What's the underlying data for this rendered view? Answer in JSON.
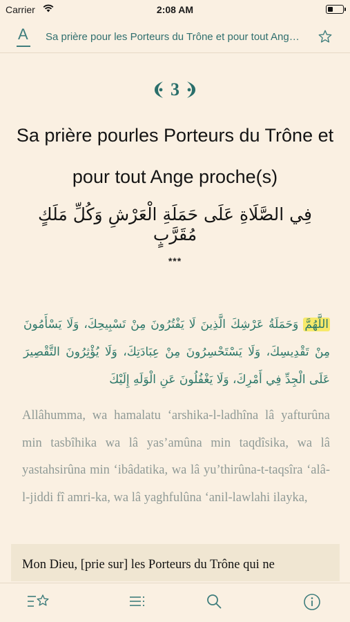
{
  "status_bar": {
    "carrier": "Carrier",
    "time": "2:08 AM"
  },
  "navbar": {
    "font_button": "A",
    "title": "Sa prière pour les Porteurs du Trône et pour tout Ange proche(s)"
  },
  "chapter": {
    "number": "3",
    "title": "Sa prière pourles Porteurs du Trône et pour tout Ange proche(s)",
    "arabic_title": "فِي الصَّلَاةِ عَلَى حَمَلَةِ الْعَرْشِ وَكُلِّ مَلَكٍ مُقَرَّبٍ",
    "separator": "***"
  },
  "verse": {
    "arabic_highlighted": "اللَّهُمَّ",
    "arabic_rest": " وَحَمَلَةُ عَرْشِكَ الَّذِينَ لَا يَفْتُرُونَ مِنْ تَسْبِيحِكَ، وَلَا يَسْأَمُونَ مِنْ تَقْدِيسِكَ، وَلَا يَسْتَحْسِرُونَ مِنْ عِبَادَتِكَ، وَلَا يُؤْثِرُونَ التَّقْصِيرَ عَلَى الْجِدِّ فِي أَمْرِكَ، وَلَا يَغْفُلُونَ عَنِ الْوَلَهِ إِلَيْكَ",
    "transliteration": "Allâhumma, wa hamalatu ‘arshika-l-ladhîna lâ yaf­turûna min tasbîhika wa lâ yas’amûna min taqdîsika, wa lâ yastahsirûna min ‘ibâdatika, wa lâ yu’thirûna-t-taqsîra ‘alâ-l-jiddi fî amri-ka, wa lâ yaghfulûna ‘anil-lawlahi ilayka,",
    "translation": "Mon Dieu, [prie sur] les Porteurs du Trône qui ne"
  },
  "colors": {
    "accent": "#2f6f6e",
    "arabic": "#2c7769",
    "background": "#faf0e2",
    "highlight": "#f7e96a"
  }
}
